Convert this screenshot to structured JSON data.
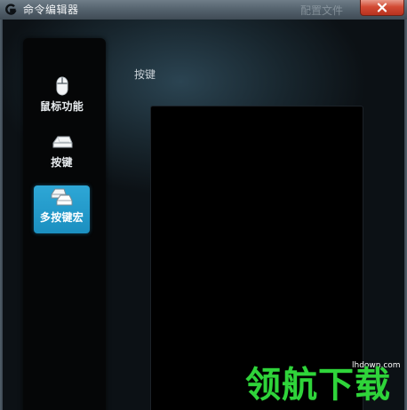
{
  "window": {
    "title": "命令编辑器",
    "ghost_title": "配置文件"
  },
  "nav": {
    "items": [
      {
        "label": "鼠标功能",
        "icon": "mouse-icon",
        "active": false
      },
      {
        "label": "按键",
        "icon": "key-icon",
        "active": false
      },
      {
        "label": "多按键宏",
        "icon": "multi-key-icon",
        "active": true
      }
    ]
  },
  "main": {
    "section_label": "按键"
  },
  "watermark": {
    "url": "lhdown.com",
    "brand": "领航下载"
  },
  "colors": {
    "accent": "#1f98c8",
    "watermark_green": "#2fd43a"
  }
}
